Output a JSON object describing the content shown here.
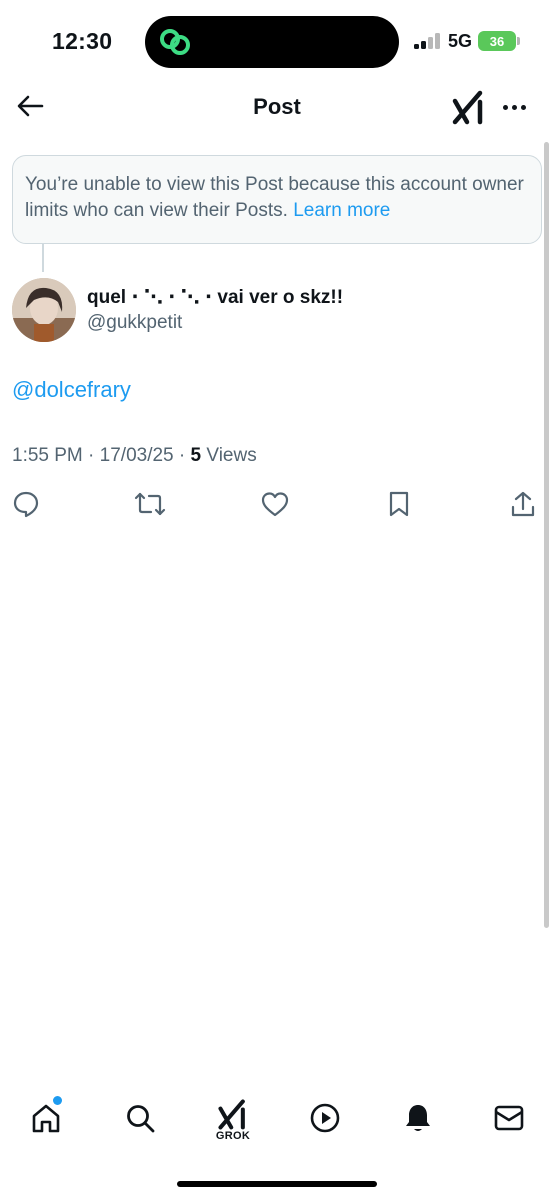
{
  "status_bar": {
    "time": "12:30",
    "network": "5G",
    "battery": "36"
  },
  "header": {
    "title": "Post",
    "back_icon": "arrow-left-icon",
    "grok_icon": "grok-icon",
    "more_icon": "more-horizontal-icon"
  },
  "notice": {
    "text": "You’re unable to view this Post because this account owner limits who can view their Posts.",
    "link": "Learn more"
  },
  "author": {
    "display_name": "quel ⋅ ⋱ ⋅ ⋱ ⋅ vai ver o skz!!",
    "handle": "@gukkpetit"
  },
  "post": {
    "mention": "@dolcefrary",
    "time": "1:55 PM",
    "date": "17/03/25",
    "views_count": "5",
    "views_label": "Views",
    "separator": "·"
  },
  "actions": [
    "reply-icon",
    "repost-icon",
    "like-icon",
    "bookmark-icon",
    "share-icon"
  ],
  "bottom_nav": {
    "items": [
      "home-icon",
      "search-icon",
      "grok-icon",
      "video-icon",
      "notifications-icon",
      "messages-icon"
    ],
    "grok_label": "GROK"
  },
  "colors": {
    "accent": "#1d9bf0",
    "secondary_text": "#536471",
    "border": "#cfd9de",
    "battery": "#5ac85a"
  }
}
